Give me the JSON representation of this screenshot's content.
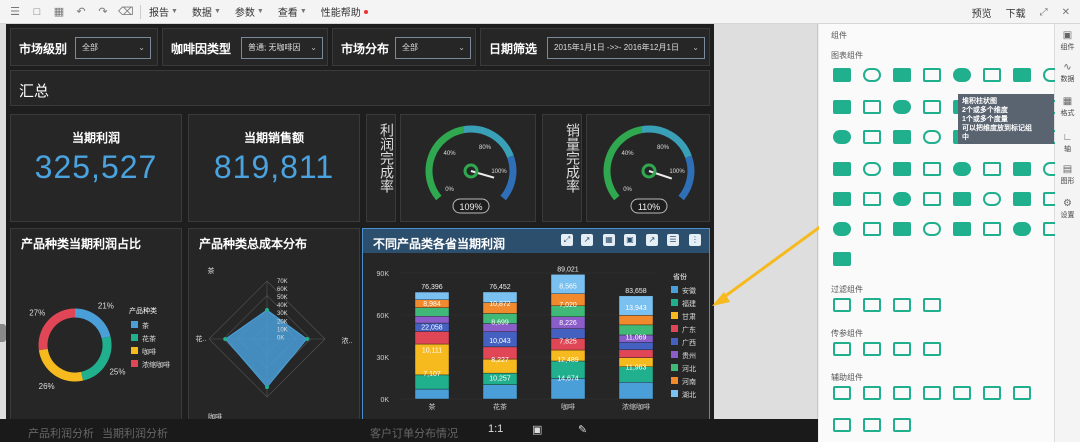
{
  "toolbar": {
    "menus": [
      "报告",
      "数据",
      "参数",
      "查看",
      "性能帮助"
    ],
    "right": [
      "预览",
      "下载"
    ]
  },
  "filters": [
    {
      "label": "市场级别",
      "value": "全部"
    },
    {
      "label": "咖啡因类型",
      "value": "普通; 无咖啡因"
    },
    {
      "label": "市场分布",
      "value": "全部"
    },
    {
      "label": "日期筛选",
      "value": "2015年1月1日 ->>- 2016年12月1日"
    }
  ],
  "summary_title": "汇总",
  "kpis": [
    {
      "title": "当期利润",
      "value": "325,527"
    },
    {
      "title": "当期销售额",
      "value": "819,811"
    }
  ],
  "gauges": [
    {
      "label": "利润完成率",
      "value_text": "109%",
      "value": 109,
      "ticks": [
        "0%",
        "40%",
        "80%",
        "100%"
      ]
    },
    {
      "label": "销量完成率",
      "value_text": "110%",
      "value": 110,
      "ticks": [
        "0%",
        "40%",
        "80%",
        "100%"
      ]
    }
  ],
  "donut": {
    "title": "产品种类当期利润占比",
    "legend_title": "产品种类",
    "colors": {
      "tea": "#4a9fd8",
      "herbal": "#21b08e",
      "coffee": "#f6b91e",
      "espresso": "#e04655"
    }
  },
  "radar": {
    "title": "产品种类总成本分布",
    "ticks": [
      "70K",
      "60K",
      "50K",
      "40K",
      "30K",
      "20K",
      "10K",
      "0K"
    ],
    "axes": [
      "茶",
      "浓..",
      "咖啡",
      "花.."
    ],
    "color": "#4a9fd8"
  },
  "stack": {
    "title": "不同产品类各省当期利润",
    "legend_title": "省份",
    "totals": [
      "76,396",
      "76,452",
      "89,021",
      "83,658"
    ],
    "y_ticks": [
      "90K",
      "60K",
      "30K",
      "0K"
    ],
    "seg_labels": [
      [
        "8,984",
        "22,058",
        "10,111",
        "7,107"
      ],
      [
        "10,872",
        "8,699",
        "10,043",
        "8,227",
        "10,257"
      ],
      [
        "8,565",
        "7,020",
        "8,226",
        "7,825",
        "12,489",
        "14,674"
      ],
      [
        "13,943",
        "11,069",
        "11,963"
      ]
    ],
    "provinces": [
      "安徽",
      "福建",
      "甘肃",
      "广东",
      "广西",
      "贵州",
      "河北",
      "河南",
      "湖北"
    ],
    "province_colors": [
      "#4a9fd8",
      "#21b08e",
      "#f6b91e",
      "#e04655",
      "#4461c2",
      "#8a5dc9",
      "#3fb878",
      "#f08a2c",
      "#7ac0f0"
    ]
  },
  "chart_data": [
    {
      "type": "pie",
      "title": "产品种类当期利润占比",
      "legend_title": "产品种类",
      "labels": [
        "茶",
        "花茶",
        "咖啡",
        "浓缩咖啡"
      ],
      "values": [
        21,
        25,
        26,
        27
      ]
    },
    {
      "type": "bar",
      "title": "不同产品类各省当期利润",
      "categories": [
        "茶",
        "花茶",
        "咖啡",
        "浓缩咖啡"
      ],
      "totals": [
        76396,
        76452,
        89021,
        83658
      ],
      "ylim": [
        0,
        90000
      ],
      "y_ticks": [
        "90K",
        "60K",
        "30K",
        "0K"
      ],
      "legend_title": "省份",
      "series": [
        {
          "name": "安徽",
          "values": [
            7107,
            10257,
            14674,
            11963
          ]
        },
        {
          "name": "福建",
          "values": [
            10111,
            8227,
            12489,
            11069
          ]
        },
        {
          "name": "甘肃",
          "values": [
            22058,
            10043,
            7825,
            6500
          ]
        },
        {
          "name": "广东",
          "values": [
            8984,
            8699,
            8226,
            5600
          ]
        },
        {
          "name": "广西",
          "values": [
            6000,
            10872,
            7020,
            5400
          ]
        },
        {
          "name": "贵州",
          "values": [
            4800,
            5800,
            8565,
            5200
          ]
        },
        {
          "name": "河北",
          "values": [
            6200,
            7200,
            7800,
            7200
          ]
        },
        {
          "name": "河南",
          "values": [
            5600,
            7800,
            8600,
            6800
          ]
        },
        {
          "name": "湖北",
          "values": [
            5536,
            7554,
            13822,
            13943
          ]
        }
      ]
    },
    {
      "type": "radar",
      "title": "产品种类总成本分布",
      "axes": [
        "茶",
        "浓..",
        "咖啡",
        "花.."
      ],
      "values": [
        35000,
        48000,
        58000,
        50000
      ],
      "rlim": [
        0,
        70000
      ]
    }
  ],
  "right_panel": {
    "section_chart": "组件",
    "chart_widgets": "图表组件",
    "tooltip": [
      "堆积柱状图",
      "2个或多个维度",
      "1个或多个度量",
      "可以把维度放到标记组",
      "中"
    ],
    "filter_widgets": "过滤组件",
    "param_widgets": "传参组件",
    "aux_widgets": "辅助组件",
    "tabs": [
      "组件",
      "数据",
      "格式",
      "轴",
      "图形",
      "设置"
    ]
  },
  "bottom": {
    "ratio": "1:1",
    "bottom_left": "产品利润分析",
    "bottom_left2": "当期利润分析",
    "bottom_mid": "客户订单分布情况"
  }
}
